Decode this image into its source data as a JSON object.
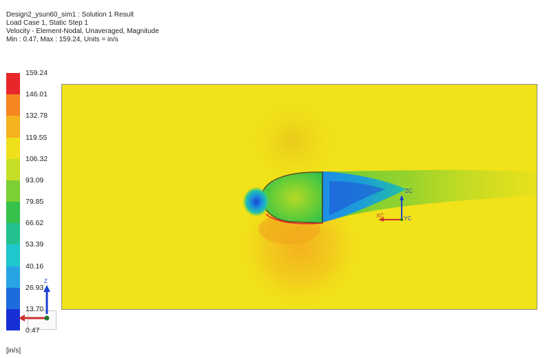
{
  "header": {
    "line1": "Design2_ysun60_sim1 : Solution 1 Result",
    "line2": "Load Case 1, Static Step 1",
    "line3": "Velocity - Element-Nodal, Unaveraged, Magnitude",
    "line4": "Min : 0.47, Max : 159.24, Units = in/s"
  },
  "legend": {
    "labels": [
      "159.24",
      "146.01",
      "132.78",
      "119.55",
      "106.32",
      "93.09",
      "79.85",
      "66.62",
      "53.39",
      "40.16",
      "26.93",
      "13.70",
      "0.47"
    ],
    "colors": [
      "#e8272a",
      "#f5851f",
      "#f4b21e",
      "#f0e01c",
      "#c6de26",
      "#7ccf34",
      "#35c14a",
      "#23c18f",
      "#1ec6cd",
      "#28a4e5",
      "#1e6bde",
      "#1630d6"
    ],
    "units": "[in/s]"
  },
  "plot": {
    "background_color": "#f1e219",
    "triad_xc": "XC",
    "triad_yc": "YC",
    "triad_zc": "ZC"
  },
  "view_triad": {
    "z_label": "Z"
  }
}
